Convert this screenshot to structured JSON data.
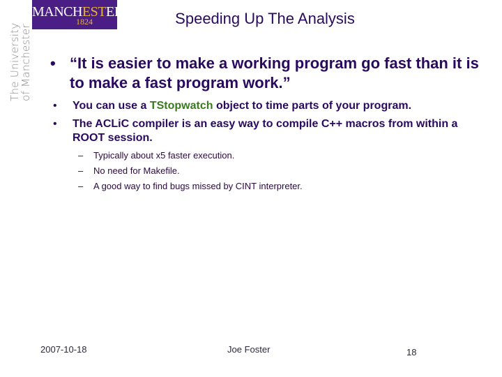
{
  "logo": {
    "name_prefix": "MANCH",
    "name_highlight": "EST",
    "name_suffix": "ER",
    "year": "1824",
    "vertical_line1": "The University",
    "vertical_line2": "of Manchester",
    "bg_color": "#4b1e86",
    "accent_color": "#e8b33a"
  },
  "slide": {
    "title": "Speeding Up The Analysis",
    "bullets": [
      {
        "marker": "•",
        "text": "“It is easier to make a working program go fast than it is to make a fast program work.”"
      },
      {
        "marker": "•",
        "text_before": "You can use a ",
        "highlight": "TStopwatch",
        "text_after": " object to time parts of your program."
      },
      {
        "marker": "•",
        "text": "The ACLiC compiler is an easy way to compile C++ macros from within a ROOT session."
      }
    ],
    "sub_bullets": [
      {
        "marker": "–",
        "text": "Typically about x5 faster execution."
      },
      {
        "marker": "–",
        "text": "No need for Makefile."
      },
      {
        "marker": "–",
        "text": "A good way to find bugs missed by CINT interpreter."
      }
    ]
  },
  "footer": {
    "date": "2007-10-18",
    "author": "Joe Foster",
    "page_number": "18"
  },
  "colors": {
    "text_primary": "#2a0a5e",
    "highlight": "#3a7a1e"
  }
}
